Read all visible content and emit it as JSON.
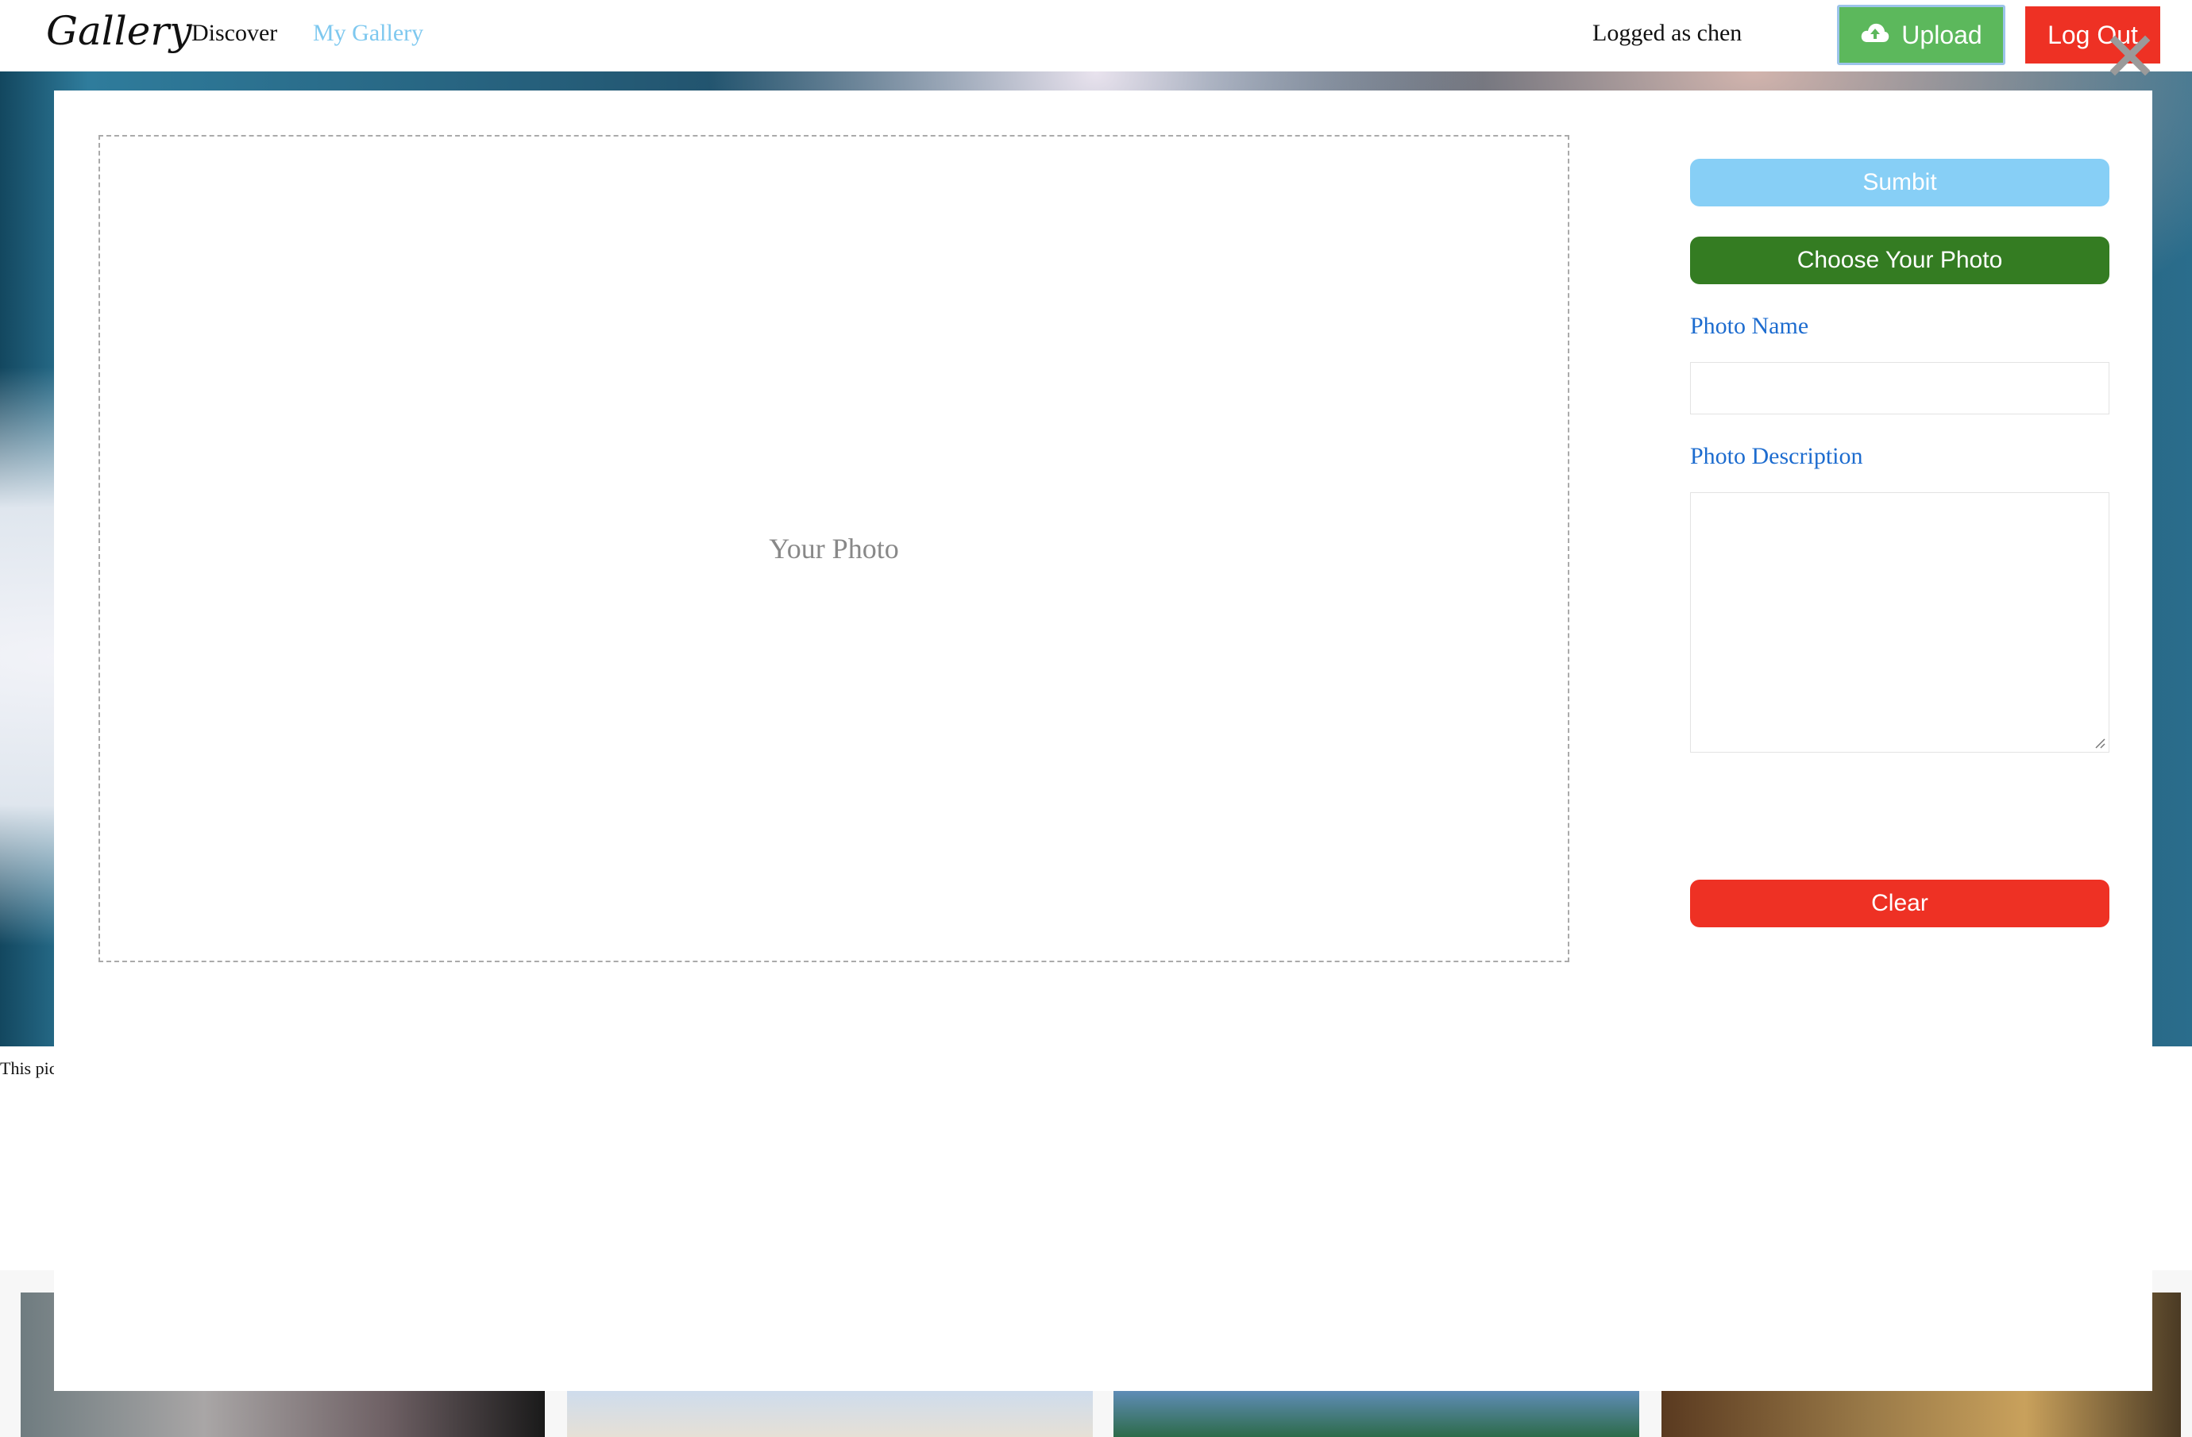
{
  "nav": {
    "brand": "Gallery",
    "links": [
      "Discover",
      "My Gallery"
    ],
    "logged_text": "Logged as chen",
    "upload_label": "Upload",
    "logout_label": "Log Out",
    "upload_icon": "cloud-upload-icon",
    "active_link_color": "#7ec8ef"
  },
  "hero": {
    "caption": "This pic"
  },
  "modal": {
    "dropzone_text": "Your Photo",
    "submit_label": "Sumbit",
    "choose_label": "Choose Your Photo",
    "name_label": "Photo Name",
    "name_value": "",
    "description_label": "Photo Description",
    "description_value": "",
    "clear_label": "Clear",
    "close_icon": "close-icon"
  },
  "colors": {
    "upload_green": "#5cb85c",
    "danger_red": "#ee3124",
    "submit_blue": "#87cff6",
    "choose_green": "#347c22",
    "label_blue": "#1d6ccf"
  }
}
